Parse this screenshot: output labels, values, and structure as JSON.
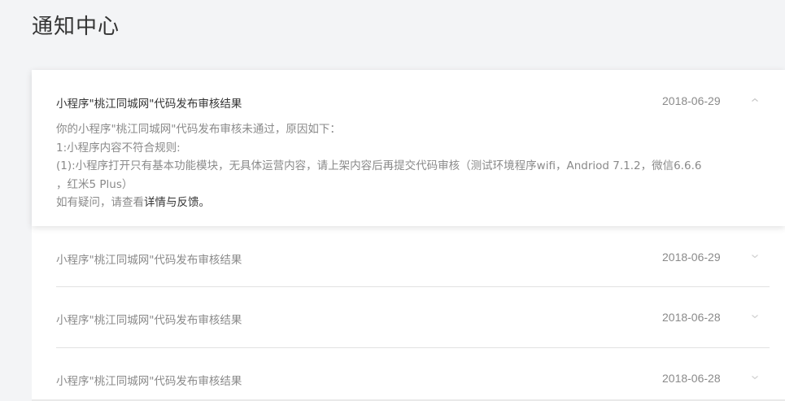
{
  "page": {
    "title": "通知中心"
  },
  "notifications": [
    {
      "title": "小程序\"桃江同城网\"代码发布审核结果",
      "date": "2018-06-29",
      "expanded": true,
      "detail": {
        "line1": "你的小程序\"桃江同城网\"代码发布审核未通过，原因如下：",
        "line2": "1:小程序内容不符合规则:",
        "line3": "(1):小程序打开只有基本功能模块，无具体运营内容，请上架内容后再提交代码审核（测试环境程序wifi，Andriod 7.1.2，微信6.6.6",
        "line4": "，红米5 Plus）",
        "line5_prefix": "如有疑问，请查看",
        "line5_link": "详情与反馈",
        "line5_suffix": "。"
      },
      "chevron_icon": "chevron-up-icon"
    },
    {
      "title": "小程序\"桃江同城网\"代码发布审核结果",
      "date": "2018-06-29",
      "expanded": false,
      "chevron_icon": "chevron-down-icon"
    },
    {
      "title": "小程序\"桃江同城网\"代码发布审核结果",
      "date": "2018-06-28",
      "expanded": false,
      "chevron_icon": "chevron-down-icon"
    },
    {
      "title": "小程序\"桃江同城网\"代码发布审核结果",
      "date": "2018-06-28",
      "expanded": false,
      "chevron_icon": "chevron-down-icon"
    }
  ],
  "colors": {
    "background": "#f3f4f6",
    "panel": "#ffffff",
    "title_text": "#353535",
    "muted_text": "#8a8a8a",
    "divider": "#e2e2e2"
  }
}
